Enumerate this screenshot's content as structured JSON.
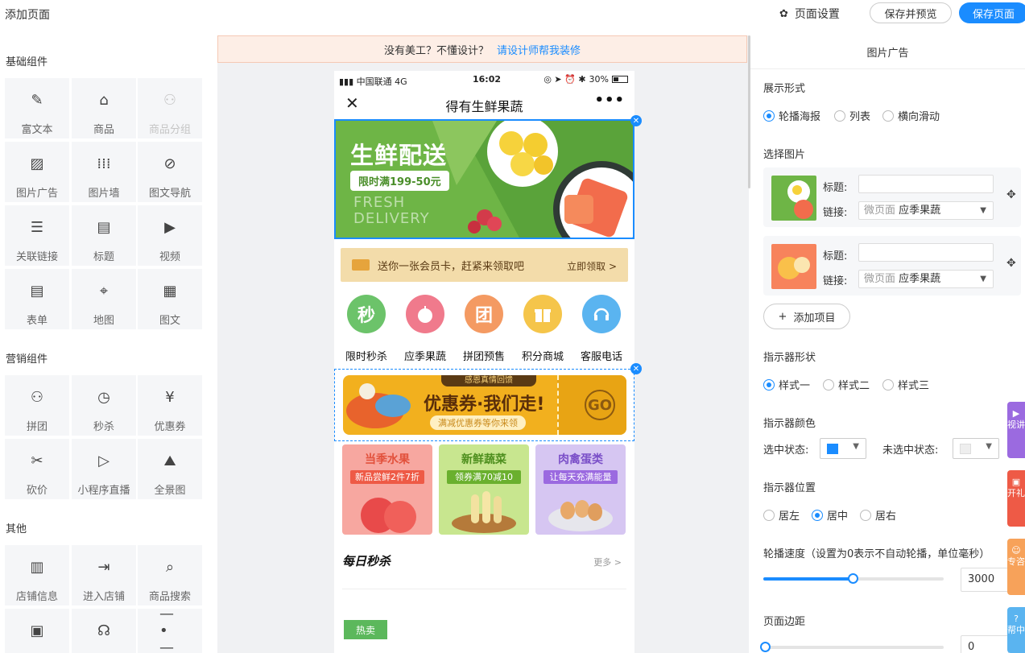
{
  "topbar": {
    "page_title": "添加页面",
    "settings_label": "页面设置",
    "preview_label": "保存并预览",
    "save_label": "保存页面"
  },
  "left": {
    "groups": [
      {
        "title": "基础组件",
        "items": [
          {
            "label": "富文本",
            "icon": "rich-text-icon",
            "disabled": false
          },
          {
            "label": "商品",
            "icon": "product-bag-icon",
            "disabled": false
          },
          {
            "label": "商品分组",
            "icon": "product-group-icon",
            "disabled": true
          },
          {
            "label": "图片广告",
            "icon": "image-ad-icon",
            "disabled": false
          },
          {
            "label": "图片墙",
            "icon": "image-wall-icon",
            "disabled": false
          },
          {
            "label": "图文导航",
            "icon": "compass-icon",
            "disabled": false
          },
          {
            "label": "关联链接",
            "icon": "list-icon",
            "disabled": false
          },
          {
            "label": "标题",
            "icon": "title-icon",
            "disabled": false
          },
          {
            "label": "视频",
            "icon": "play-icon",
            "disabled": false
          },
          {
            "label": "表单",
            "icon": "form-icon",
            "disabled": false
          },
          {
            "label": "地图",
            "icon": "map-icon",
            "disabled": false
          },
          {
            "label": "图文",
            "icon": "article-icon",
            "disabled": false
          }
        ]
      },
      {
        "title": "营销组件",
        "items": [
          {
            "label": "拼团",
            "icon": "group-buy-icon",
            "disabled": false
          },
          {
            "label": "秒杀",
            "icon": "clock-icon",
            "disabled": false
          },
          {
            "label": "优惠券",
            "icon": "coupon-icon",
            "disabled": false
          },
          {
            "label": "砍价",
            "icon": "bargain-tag-icon",
            "disabled": false
          },
          {
            "label": "小程序直播",
            "icon": "live-tv-icon",
            "disabled": false
          },
          {
            "label": "全景图",
            "icon": "panorama-icon",
            "disabled": false
          }
        ]
      },
      {
        "title": "其他",
        "items": [
          {
            "label": "店铺信息",
            "icon": "store-icon",
            "disabled": false
          },
          {
            "label": "进入店铺",
            "icon": "enter-store-icon",
            "disabled": false
          },
          {
            "label": "商品搜索",
            "icon": "search-icon",
            "disabled": false
          },
          {
            "label": "",
            "icon": "shop-box-icon",
            "disabled": false
          },
          {
            "label": "",
            "icon": "headset-icon",
            "disabled": false
          },
          {
            "label": "",
            "icon": "divider-icon",
            "disabled": false
          }
        ]
      }
    ]
  },
  "notice": {
    "text": "没有美工？不懂设计？",
    "link": "请设计师帮我装修"
  },
  "phone": {
    "carrier": "中国联通  4G",
    "time": "16:02",
    "battery": "30%",
    "title": "得有生鲜果蔬",
    "banner": {
      "headline": "生鲜配送",
      "promo": "限时满199-50元",
      "en1": "FRESH",
      "en2": "DELIVERY"
    },
    "vip": {
      "text": "送你一张会员卡，赶紧来领取吧",
      "action": "立即领取 >"
    },
    "nav_icons": [
      {
        "glyph": "秒",
        "label": "限时秒杀",
        "color": "#6cc36a"
      },
      {
        "glyph": "",
        "label": "应季果蔬",
        "color": "#f07a8c"
      },
      {
        "glyph": "团",
        "label": "拼团预售",
        "color": "#f49a62"
      },
      {
        "glyph": "",
        "label": "积分商城",
        "color": "#f5c54a"
      },
      {
        "glyph": "",
        "label": "客服电话",
        "color": "#5ab4f0"
      }
    ],
    "coupon": {
      "top": "感恩真情回馈",
      "main": "优惠券·我们走!",
      "sub": "满减优惠券等你来领",
      "go": "GO"
    },
    "categories": [
      {
        "title": "当季水果",
        "tag": "新品尝鲜2件7折",
        "bg": "#f7a7a0",
        "title_color": "#e2513c",
        "tag_color": "#ee5a46"
      },
      {
        "title": "新鲜蔬菜",
        "tag": "领券满70减10",
        "bg": "#c8e68f",
        "title_color": "#4e8f1e",
        "tag_color": "#6ab02e"
      },
      {
        "title": "肉禽蛋类",
        "tag": "让每天充满能量",
        "bg": "#d6c6f2",
        "title_color": "#7a4fc8",
        "tag_color": "#9b6ae0"
      }
    ],
    "seckill_title": "每日秒杀",
    "seckill_more": "更多 >",
    "hot_label": "热卖"
  },
  "right": {
    "header": "图片广告",
    "display_label": "展示形式",
    "display_options": [
      "轮播海报",
      "列表",
      "横向滑动"
    ],
    "display_selected": 0,
    "choose_label": "选择图片",
    "items": [
      {
        "title_key": "标题:",
        "link_key": "链接:",
        "link_prefix": "微页面",
        "link_value": "应季果蔬"
      },
      {
        "title_key": "标题:",
        "link_key": "链接:",
        "link_prefix": "微页面",
        "link_value": "应季果蔬"
      }
    ],
    "add_item": "添加项目",
    "indicator_shape_label": "指示器形状",
    "indicator_shapes": [
      "样式一",
      "样式二",
      "样式三"
    ],
    "indicator_color_label": "指示器颜色",
    "selected_state": "选中状态:",
    "unselected_state": "未选中状态:",
    "selected_color": "#1a8cff",
    "unselected_color": "#eeeeee",
    "indicator_pos_label": "指示器位置",
    "positions": [
      "居左",
      "居中",
      "居右"
    ],
    "speed_label": "轮播速度（设置为0表示不自动轮播，单位毫秒）",
    "speed_value": "3000",
    "margin_label": "页面边距",
    "margin_value": "0"
  },
  "floats": [
    {
      "text": "视讲",
      "color": "#9b6ae0"
    },
    {
      "text": "开礼",
      "color": "#ee5a46"
    },
    {
      "text": "专咨",
      "color": "#f7a25a"
    },
    {
      "text": "帮中",
      "color": "#5ab4f0"
    }
  ]
}
